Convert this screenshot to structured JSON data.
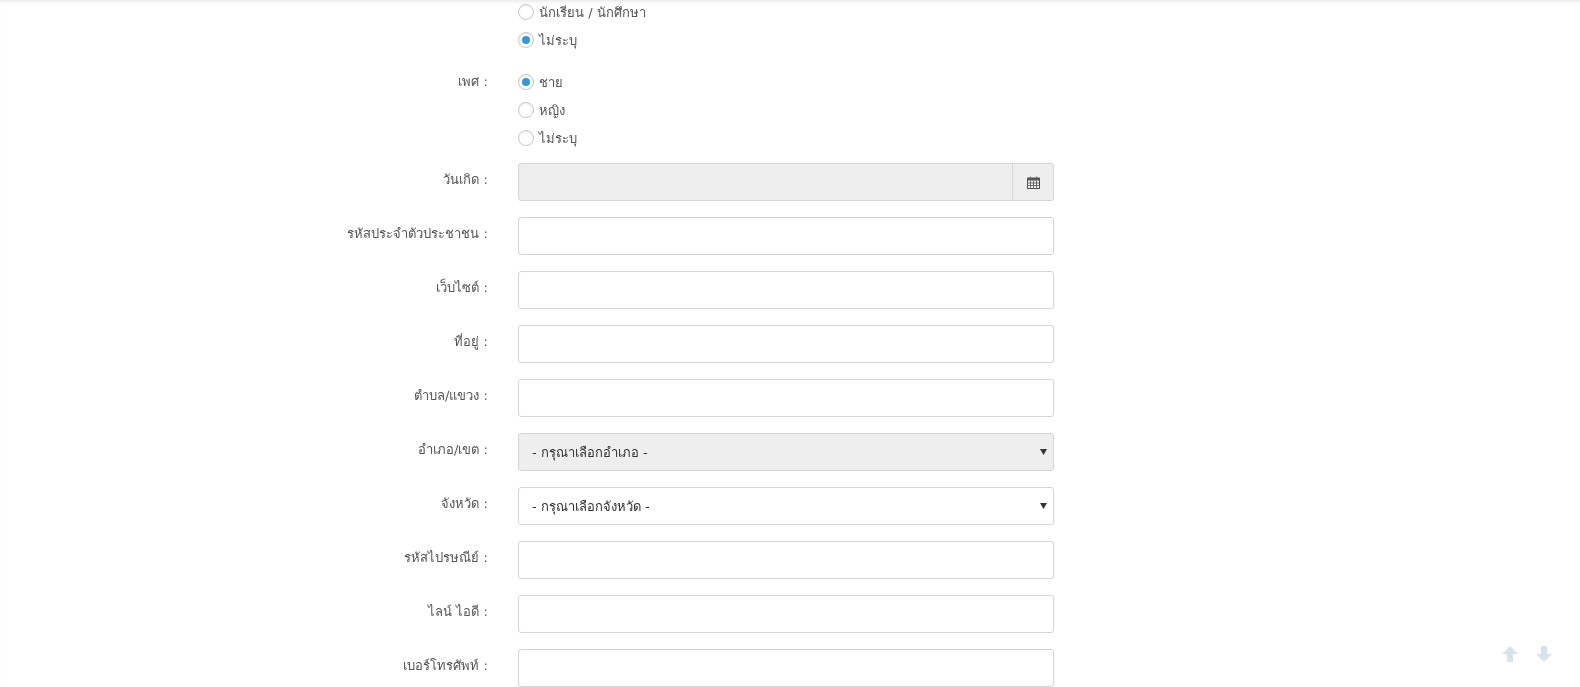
{
  "radio_groups": [
    {
      "options": [
        {
          "label": "นักเรียน / นักศึกษา",
          "selected": false
        },
        {
          "label": "ไม่ระบุ",
          "selected": true
        }
      ]
    },
    {
      "label": "เพศ :",
      "options": [
        {
          "label": "ชาย",
          "selected": true
        },
        {
          "label": "หญิง",
          "selected": false
        },
        {
          "label": "ไม่ระบุ",
          "selected": false
        }
      ]
    }
  ],
  "fields": [
    {
      "label": "วันเกิด :",
      "kind": "date",
      "disabled": true
    },
    {
      "label": "รหัสประจำตัวประชาชน :",
      "kind": "text",
      "disabled": false
    },
    {
      "label": "เว็บไซต์ :",
      "kind": "text",
      "disabled": false
    },
    {
      "label": "ที่อยู่ :",
      "kind": "text",
      "disabled": false
    },
    {
      "label": "ตำบล/แขวง :",
      "kind": "text",
      "disabled": false
    },
    {
      "label": "อำเภอ/เขต :",
      "kind": "select",
      "value": "- กรุณาเลือกอำเภอ -",
      "disabled": true
    },
    {
      "label": "จังหวัด :",
      "kind": "select",
      "value": "- กรุณาเลือกจังหวัด -",
      "disabled": false
    },
    {
      "label": "รหัสไปรษณีย์ :",
      "kind": "text",
      "disabled": false
    },
    {
      "label": "ไลน์ ไอดี :",
      "kind": "text",
      "disabled": false
    },
    {
      "label": "เบอร์โทรศัพท์ :",
      "kind": "text",
      "disabled": false
    }
  ]
}
